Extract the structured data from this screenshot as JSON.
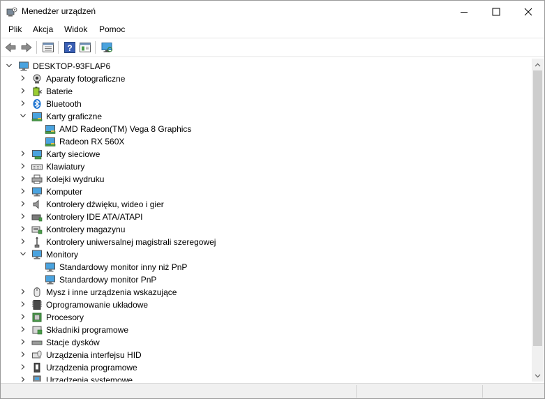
{
  "window": {
    "title": "Menedżer urządzeń"
  },
  "menu": [
    "Plik",
    "Akcja",
    "Widok",
    "Pomoc"
  ],
  "toolbar": [
    {
      "name": "back-button",
      "icon": "arrow-left-icon"
    },
    {
      "name": "forward-button",
      "icon": "arrow-right-icon"
    },
    {
      "name": "properties-view-button",
      "icon": "properties-icon"
    },
    {
      "name": "help-button",
      "icon": "help-icon"
    },
    {
      "name": "details-view-button",
      "icon": "details-icon"
    },
    {
      "name": "scan-hardware-button",
      "icon": "monitor-scan-icon"
    }
  ],
  "tree": {
    "root": "DESKTOP-93FLAP6",
    "items": [
      {
        "label": "Aparaty fotograficzne",
        "level": 1,
        "expanded": false,
        "icon": "camera-icon"
      },
      {
        "label": "Baterie",
        "level": 1,
        "expanded": false,
        "icon": "battery-icon"
      },
      {
        "label": "Bluetooth",
        "level": 1,
        "expanded": false,
        "icon": "bluetooth-icon"
      },
      {
        "label": "Karty graficzne",
        "level": 1,
        "expanded": true,
        "icon": "display-adapter-icon"
      },
      {
        "label": "AMD Radeon(TM) Vega 8 Graphics",
        "level": 2,
        "icon": "display-adapter-icon"
      },
      {
        "label": "Radeon RX 560X",
        "level": 2,
        "icon": "display-adapter-icon"
      },
      {
        "label": "Karty sieciowe",
        "level": 1,
        "expanded": false,
        "icon": "network-adapter-icon"
      },
      {
        "label": "Klawiatury",
        "level": 1,
        "expanded": false,
        "icon": "keyboard-icon"
      },
      {
        "label": "Kolejki wydruku",
        "level": 1,
        "expanded": false,
        "icon": "printer-icon"
      },
      {
        "label": "Komputer",
        "level": 1,
        "expanded": false,
        "icon": "computer-icon"
      },
      {
        "label": "Kontrolery dźwięku, wideo i gier",
        "level": 1,
        "expanded": false,
        "icon": "speaker-icon"
      },
      {
        "label": "Kontrolery IDE ATA/ATAPI",
        "level": 1,
        "expanded": false,
        "icon": "ide-controller-icon"
      },
      {
        "label": "Kontrolery magazynu",
        "level": 1,
        "expanded": false,
        "icon": "storage-controller-icon"
      },
      {
        "label": "Kontrolery uniwersalnej magistrali szeregowej",
        "level": 1,
        "expanded": false,
        "icon": "usb-icon"
      },
      {
        "label": "Monitory",
        "level": 1,
        "expanded": true,
        "icon": "monitor-icon"
      },
      {
        "label": "Standardowy monitor inny niż PnP",
        "level": 2,
        "icon": "monitor-icon"
      },
      {
        "label": "Standardowy monitor PnP",
        "level": 2,
        "icon": "monitor-icon"
      },
      {
        "label": "Mysz i inne urządzenia wskazujące",
        "level": 1,
        "expanded": false,
        "icon": "mouse-icon"
      },
      {
        "label": "Oprogramowanie układowe",
        "level": 1,
        "expanded": false,
        "icon": "firmware-icon"
      },
      {
        "label": "Procesory",
        "level": 1,
        "expanded": false,
        "icon": "processor-icon"
      },
      {
        "label": "Składniki programowe",
        "level": 1,
        "expanded": false,
        "icon": "software-component-icon"
      },
      {
        "label": "Stacje dysków",
        "level": 1,
        "expanded": false,
        "icon": "disk-drive-icon"
      },
      {
        "label": "Urządzenia interfejsu HID",
        "level": 1,
        "expanded": false,
        "icon": "hid-icon"
      },
      {
        "label": "Urządzenia programowe",
        "level": 1,
        "expanded": false,
        "icon": "software-device-icon"
      },
      {
        "label": "Urządzenia systemowe",
        "level": 1,
        "expanded": false,
        "icon": "system-device-icon"
      }
    ]
  },
  "colors": {
    "accent": "#2b7cd3",
    "window_border": "#9a9a9a",
    "statusbar": "#f0f0f0"
  }
}
